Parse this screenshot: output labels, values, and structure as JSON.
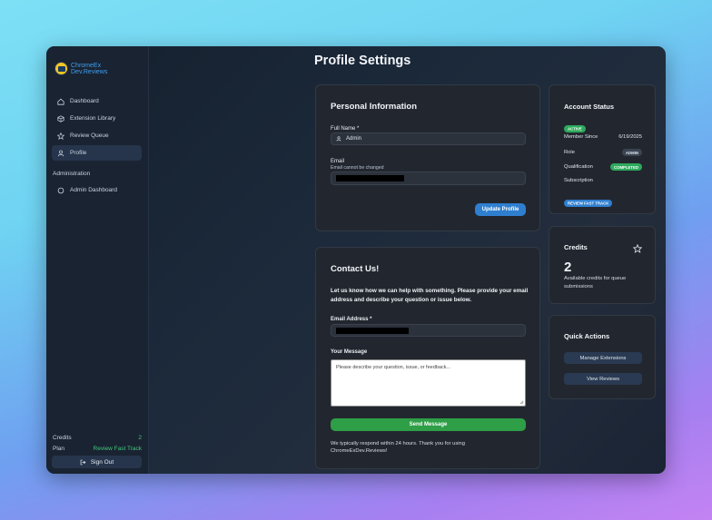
{
  "sidebar": {
    "logo": {
      "line1": "ChromeEx",
      "line2": "Dev.Reviews"
    },
    "nav": [
      {
        "label": "Dashboard",
        "icon": "home-icon"
      },
      {
        "label": "Extension Library",
        "icon": "cube-icon"
      },
      {
        "label": "Review Queue",
        "icon": "star-icon"
      },
      {
        "label": "Profile",
        "icon": "user-icon",
        "active": true
      }
    ],
    "section_label": "Administration",
    "admin_item": {
      "label": "Admin Dashboard",
      "icon": "circle-icon"
    },
    "footer": {
      "credits_label": "Credits",
      "credits_value": "2",
      "plan_label": "Plan",
      "plan_value": "Review Fast Track"
    },
    "sign_out_label": "Sign Out"
  },
  "page": {
    "title": "Profile Settings"
  },
  "personal": {
    "title": "Personal Information",
    "full_name_label": "Full Name *",
    "full_name_value": "Admin",
    "email_label": "Email",
    "email_hint": "Email cannot be changed",
    "update_button": "Update Profile"
  },
  "contact": {
    "title": "Contact Us!",
    "description": "Let us know how we can help with something. Please provide your email address and describe your question or issue below.",
    "email_label": "Email Address *",
    "message_label": "Your Message",
    "message_placeholder": "Please describe your question, issue, or feedback...",
    "send_button": "Send Message",
    "note": "We typically respond within 24 hours. Thank you for using ChromeExDev.Reviews!"
  },
  "account": {
    "title": "Account Status",
    "status_badge": "ACTIVE",
    "member_since_label": "Member Since",
    "member_since_value": "6/19/2025",
    "role_label": "Role",
    "role_value": "ADMIN",
    "qualification_label": "Qualification",
    "qualification_value": "COMPLETED",
    "subscription_label": "Subscription",
    "subscription_value": "REVIEW FAST TRACK"
  },
  "credits": {
    "title": "Credits",
    "value": "2",
    "description": "Available credits for queue submissions"
  },
  "quick_actions": {
    "title": "Quick Actions",
    "manage_button": "Manage Extensions",
    "view_button": "View Reviews"
  },
  "colors": {
    "accent_blue": "#2f7fd0",
    "success_green": "#2e9e47",
    "card_bg": "#22272f"
  }
}
